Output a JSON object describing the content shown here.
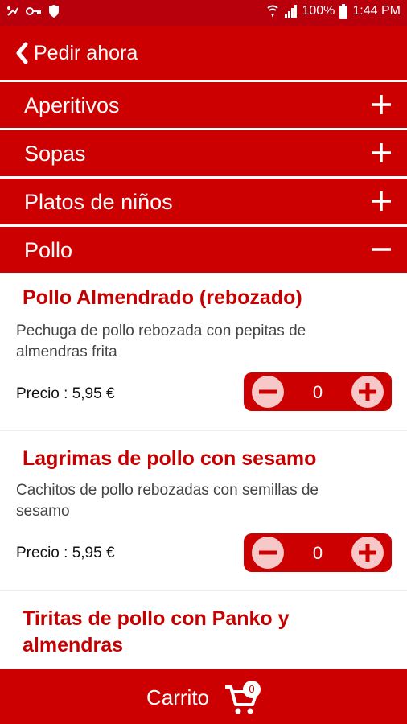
{
  "status_bar": {
    "battery": "100%",
    "time": "1:44 PM",
    "icons": [
      "notification-icon",
      "key-icon",
      "shield-icon",
      "wifi-calling-icon",
      "signal-icon",
      "battery-icon"
    ]
  },
  "app_bar": {
    "back_label": "Pedir ahora",
    "icon": "chevron-left-icon"
  },
  "categories": [
    {
      "label": "Aperitivos",
      "toggle": "plus-icon"
    },
    {
      "label": "Sopas",
      "toggle": "plus-icon"
    },
    {
      "label": "Platos de niños",
      "toggle": "plus-icon"
    },
    {
      "label": "Pollo",
      "toggle": "minus-icon"
    }
  ],
  "items": [
    {
      "name": "Pollo Almendrado (rebozado)",
      "desc_line1": "Pechuga de pollo rebozada con pepitas de",
      "desc_line2": "almendras frita",
      "price": "Precio : 5,95 €",
      "quantity": "0"
    },
    {
      "name": "Lagrimas de pollo con sesamo",
      "desc_line1": "Cachitos de pollo rebozadas con semillas de",
      "desc_line2": "sesamo",
      "price": "Precio : 5,95 €",
      "quantity": "0"
    },
    {
      "name_line1": "Tiritas de pollo con Panko y",
      "name_line2": "almendras"
    }
  ],
  "bottom_bar": {
    "cart_label": "Carrito",
    "cart_count": "0",
    "icon": "shopping-cart-icon"
  },
  "colors": {
    "primary": "#cc0000",
    "status_bar": "#b8000c",
    "item_title": "#c40000",
    "stepper_button": "#f7c8c8"
  }
}
